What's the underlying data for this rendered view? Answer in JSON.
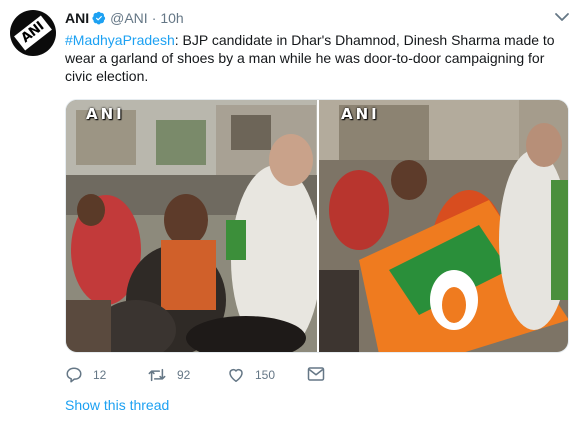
{
  "tweet": {
    "author_name": "ANI",
    "handle": "@ANI",
    "separator": "·",
    "time": "10h",
    "avatar_text": "ANI",
    "hashtag": "#MadhyaPradesh",
    "body": ": BJP candidate in Dhar's Dhamnod, Dinesh Sharma made to wear a garland of shoes by a man while he was door-to-door campaigning for civic election.",
    "media": {
      "left_watermark": "ANI",
      "right_watermark": "ANI"
    },
    "actions": {
      "replies": "12",
      "retweets": "92",
      "likes": "150"
    },
    "show_thread": "Show this thread"
  },
  "colors": {
    "link": "#1da1f2",
    "secondary_text": "#657786",
    "primary_text": "#14171a"
  }
}
